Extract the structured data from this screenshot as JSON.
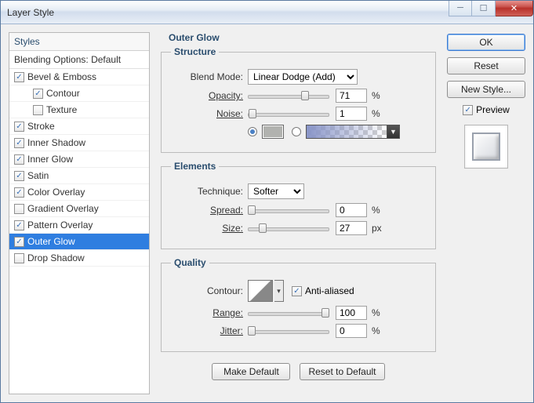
{
  "window": {
    "title": "Layer Style"
  },
  "sidebar": {
    "header": "Styles",
    "blending": "Blending Options: Default",
    "items": [
      {
        "label": "Bevel & Emboss",
        "checked": true,
        "sub": false,
        "selected": false
      },
      {
        "label": "Contour",
        "checked": true,
        "sub": true,
        "selected": false
      },
      {
        "label": "Texture",
        "checked": false,
        "sub": true,
        "selected": false
      },
      {
        "label": "Stroke",
        "checked": true,
        "sub": false,
        "selected": false
      },
      {
        "label": "Inner Shadow",
        "checked": true,
        "sub": false,
        "selected": false
      },
      {
        "label": "Inner Glow",
        "checked": true,
        "sub": false,
        "selected": false
      },
      {
        "label": "Satin",
        "checked": true,
        "sub": false,
        "selected": false
      },
      {
        "label": "Color Overlay",
        "checked": true,
        "sub": false,
        "selected": false
      },
      {
        "label": "Gradient Overlay",
        "checked": false,
        "sub": false,
        "selected": false
      },
      {
        "label": "Pattern Overlay",
        "checked": true,
        "sub": false,
        "selected": false
      },
      {
        "label": "Outer Glow",
        "checked": true,
        "sub": false,
        "selected": true
      },
      {
        "label": "Drop Shadow",
        "checked": false,
        "sub": false,
        "selected": false
      }
    ]
  },
  "main": {
    "title": "Outer Glow",
    "structure": {
      "legend": "Structure",
      "blend_mode_label": "Blend Mode:",
      "blend_mode_value": "Linear Dodge (Add)",
      "opacity_label": "Opacity:",
      "opacity_value": "71",
      "opacity_unit": "%",
      "noise_label": "Noise:",
      "noise_value": "1",
      "noise_unit": "%"
    },
    "elements": {
      "legend": "Elements",
      "technique_label": "Technique:",
      "technique_value": "Softer",
      "spread_label": "Spread:",
      "spread_value": "0",
      "spread_unit": "%",
      "size_label": "Size:",
      "size_value": "27",
      "size_unit": "px"
    },
    "quality": {
      "legend": "Quality",
      "contour_label": "Contour:",
      "anti_aliased_label": "Anti-aliased",
      "range_label": "Range:",
      "range_value": "100",
      "range_unit": "%",
      "jitter_label": "Jitter:",
      "jitter_value": "0",
      "jitter_unit": "%"
    },
    "buttons": {
      "make_default": "Make Default",
      "reset_default": "Reset to Default"
    }
  },
  "right": {
    "ok": "OK",
    "reset": "Reset",
    "new_style": "New Style...",
    "preview": "Preview"
  }
}
